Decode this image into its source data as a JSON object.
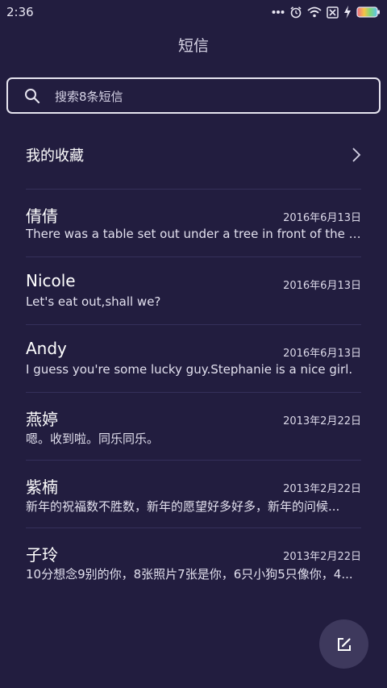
{
  "status_bar": {
    "time": "2:36",
    "icons": [
      "more-dots-icon",
      "alarm-icon",
      "wifi-icon",
      "sim-off-icon",
      "charging-icon",
      "battery-icon"
    ]
  },
  "header": {
    "title": "短信"
  },
  "search": {
    "placeholder": "搜索8条短信",
    "icon": "search-icon"
  },
  "favorites": {
    "label": "我的收藏",
    "icon": "chevron-right-icon"
  },
  "messages": [
    {
      "name": "倩倩",
      "date": "2016年6月13日",
      "preview": "There was a table set out under a tree in front of the ho..."
    },
    {
      "name": "Nicole",
      "date": "2016年6月13日",
      "preview": "Let's eat out,shall we?"
    },
    {
      "name": "Andy",
      "date": "2016年6月13日",
      "preview": "I guess you're some lucky guy.Stephanie is a nice girl."
    },
    {
      "name": "燕婷",
      "date": "2013年2月22日",
      "preview": "嗯。收到啦。同乐同乐。"
    },
    {
      "name": "紫楠",
      "date": "2013年2月22日",
      "preview": "新年的祝福数不胜数，新年的愿望好多好多，新年的问候..."
    },
    {
      "name": "子玲",
      "date": "2013年2月22日",
      "preview": "10分想念9别的你，8张照片7张是你，6只小狗5只像你，4..."
    }
  ],
  "compose_button": {
    "icon": "compose-icon"
  },
  "colors": {
    "background": "#221d3f",
    "divider": "#35305a",
    "fab": "#3e395d",
    "text": "#ffffff"
  }
}
